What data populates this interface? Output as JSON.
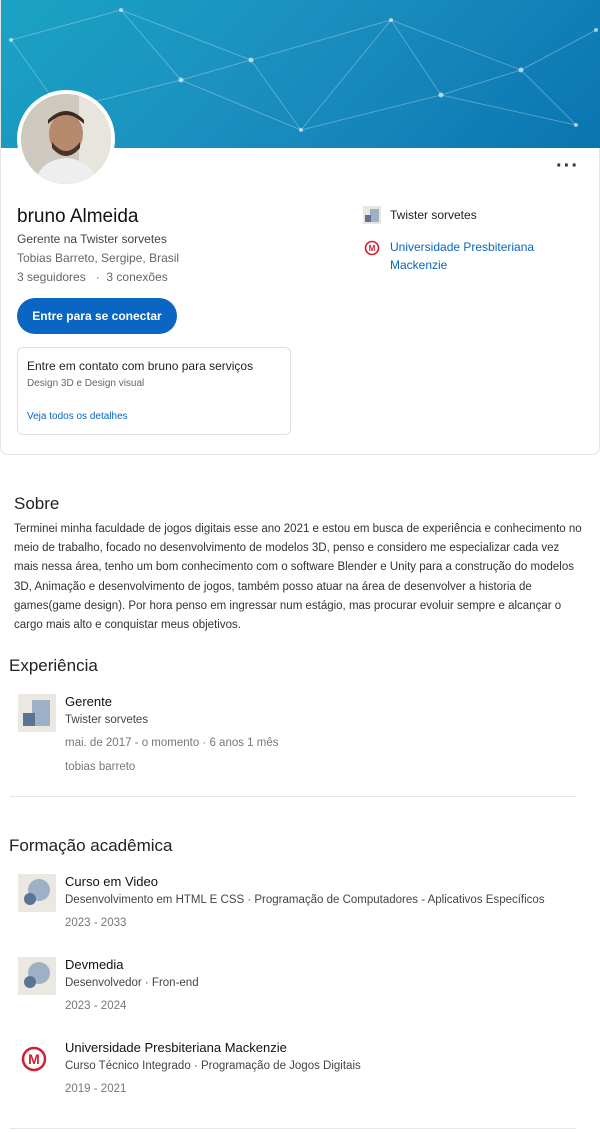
{
  "profile": {
    "name": "bruno Almeida",
    "headline": "Gerente na Twister sorvetes",
    "location": "Tobias Barreto, Sergipe, Brasil",
    "followers": "3 seguidores",
    "separator": "·",
    "connections": "3 conexões",
    "more_label": "···",
    "connect_label": "Entre para se conectar"
  },
  "contact": {
    "title": "Entre em contato com bruno para serviços",
    "services": "Design 3D e Design visual",
    "link": "Veja todos os detalhes"
  },
  "side": {
    "company": "Twister sorvetes",
    "school": "Universidade Presbiteriana Mackenzie"
  },
  "about": {
    "title": "Sobre",
    "text": "Terminei minha faculdade de jogos digitais esse ano 2021 e estou em busca de experiência e conhecimento no meio de trabalho, focado no desenvolvimento de modelos 3D, penso e considero me especializar cada vez mais nessa área, tenho um bom conhecimento com o software Blender e Unity para a construção do modelos 3D, Animação e desenvolvimento de jogos, também posso atuar na área de desenvolver a historia de games(game design). Por hora penso em ingressar num estágio, mas procurar evoluir sempre e alcançar o cargo mais alto e conquistar meus objetivos."
  },
  "experience": {
    "title": "Experiência",
    "items": [
      {
        "role": "Gerente",
        "company": "Twister sorvetes",
        "period": "mai. de 2017 - o momento · 6 anos 1 mês",
        "location": "tobias barreto"
      }
    ]
  },
  "education": {
    "title": "Formação acadêmica",
    "items": [
      {
        "school": "Curso em Video",
        "detail": "Desenvolvimento em HTML E CSS · Programação de Computadores - Aplicativos Específicos",
        "years": "2023 - 2033"
      },
      {
        "school": "Devmedia",
        "detail": "Desenvolvedor · Fron-end",
        "years": "2023 - 2024"
      },
      {
        "school": "Universidade Presbiteriana Mackenzie",
        "detail": "Curso Técnico Integrado · Programação de Jogos Digitais",
        "years": "2019 - 2021"
      }
    ]
  },
  "colors": {
    "accent": "#0a66c2",
    "mackenzie_red": "#d01f2e",
    "banner_start": "#1aa3c4",
    "banner_end": "#0a75b0"
  },
  "icons": {
    "company_logo": "company-placeholder-icon",
    "school_placeholder": "school-placeholder-icon",
    "mackenzie_logo": "mackenzie-logo-icon",
    "more": "more-horizontal-icon"
  }
}
